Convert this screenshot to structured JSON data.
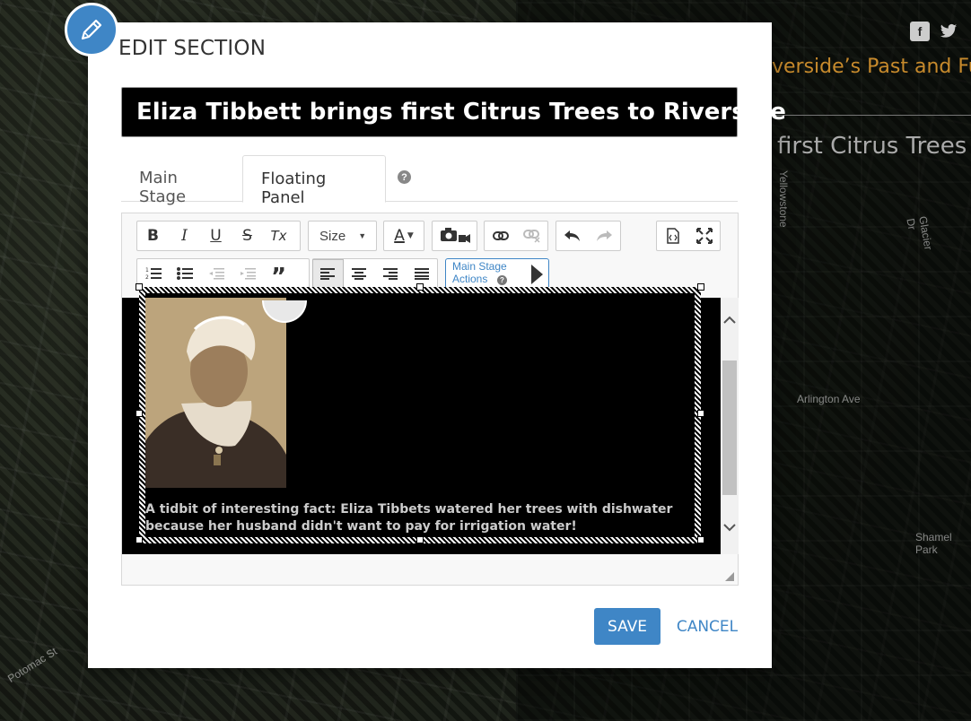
{
  "background": {
    "story_title": "verside’s Past and Fu",
    "story_heading": "first Citrus Trees",
    "map_labels": [
      "Arlington Ave",
      "Yellowstone",
      "Shamel Park",
      "Potomac St",
      "Glacier Dr"
    ],
    "share_icons": [
      "facebook-icon",
      "twitter-icon"
    ],
    "accent_color": "#c78a2c"
  },
  "modal": {
    "title": "EDIT SECTION",
    "section_title_value": "Eliza Tibbett brings first Citrus Trees to Riverside",
    "tabs": [
      {
        "label": "Main Stage",
        "active": false
      },
      {
        "label": "Floating Panel",
        "active": true
      }
    ],
    "help_icon": "?"
  },
  "editor": {
    "toolbar": {
      "bold": "B",
      "italic": "I",
      "underline": "U",
      "strike": "S",
      "clear_format": "Tx",
      "size_label": "Size",
      "font_color": "A",
      "main_stage_actions_label": "Main Stage Actions"
    },
    "content": {
      "caption": "A tidbit of interesting fact: Eliza Tibbets watered her trees with dishwater because her husband didn't want to pay for irrigation water!"
    }
  },
  "buttons": {
    "save": "SAVE",
    "cancel": "CANCEL"
  },
  "colors": {
    "primary": "#3f86c6",
    "title_input_bg": "#000000"
  }
}
